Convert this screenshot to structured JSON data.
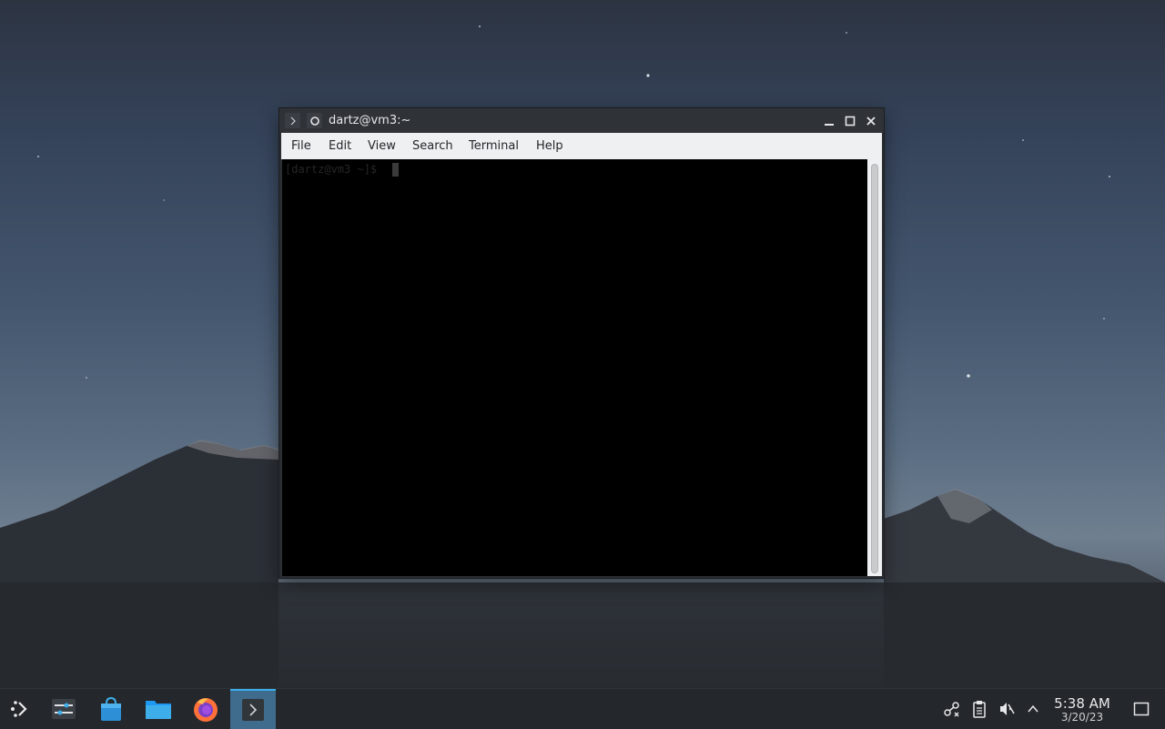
{
  "window": {
    "title": "dartz@vm3:~",
    "menu": [
      "File",
      "Edit",
      "View",
      "Search",
      "Terminal",
      "Help"
    ]
  },
  "terminal": {
    "prompt": "[dartz@vm3 ~]$"
  },
  "taskbar": {
    "apps": [
      "application-launcher-icon",
      "system-settings-icon",
      "discover-store-icon",
      "file-manager-icon",
      "firefox-icon",
      "terminal-icon"
    ],
    "active_app": "terminal-icon",
    "clock": {
      "time": "5:38 AM",
      "date": "3/20/23"
    },
    "tray": [
      "network-icon",
      "clipboard-icon",
      "volume-muted-icon",
      "expand-tray-icon",
      "show-desktop-icon"
    ]
  },
  "colors": {
    "accent": "#3daee9",
    "taskbar": "#24272b",
    "terminal_bg": "#000000",
    "menubar_bg": "#eff0f1"
  }
}
